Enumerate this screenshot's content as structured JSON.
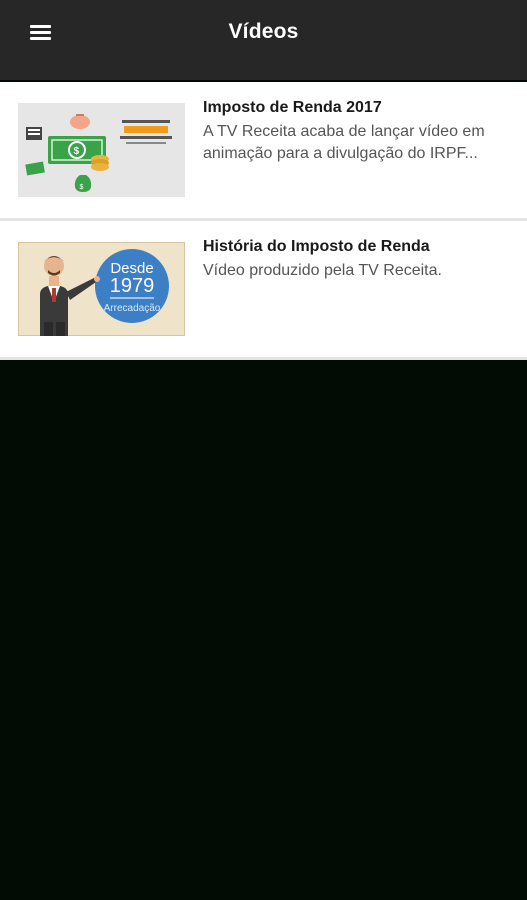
{
  "appbar": {
    "title": "Vídeos",
    "menu_icon": "hamburger-menu-icon"
  },
  "videos": [
    {
      "title": "Imposto de Renda 2017",
      "description_line1": "A TV Receita acaba de lançar vídeo em",
      "description_line2": "animação para a divulgação do IRPF...",
      "thumbnail_icon": "money-animation-thumbnail"
    },
    {
      "title": "História do Imposto de Renda",
      "description_line1": "Vídeo produzido pela TV Receita.",
      "thumbnail_icon": "history-presenter-thumbnail",
      "thumbnail_badge_line1": "Desde",
      "thumbnail_badge_line2": "1979",
      "thumbnail_badge_line3": "Arrecadação"
    }
  ],
  "colors": {
    "appbar_bg": "#272727",
    "page_bg": "#020c05",
    "card_bg": "#ffffff",
    "badge_blue": "#3d7fc4"
  }
}
